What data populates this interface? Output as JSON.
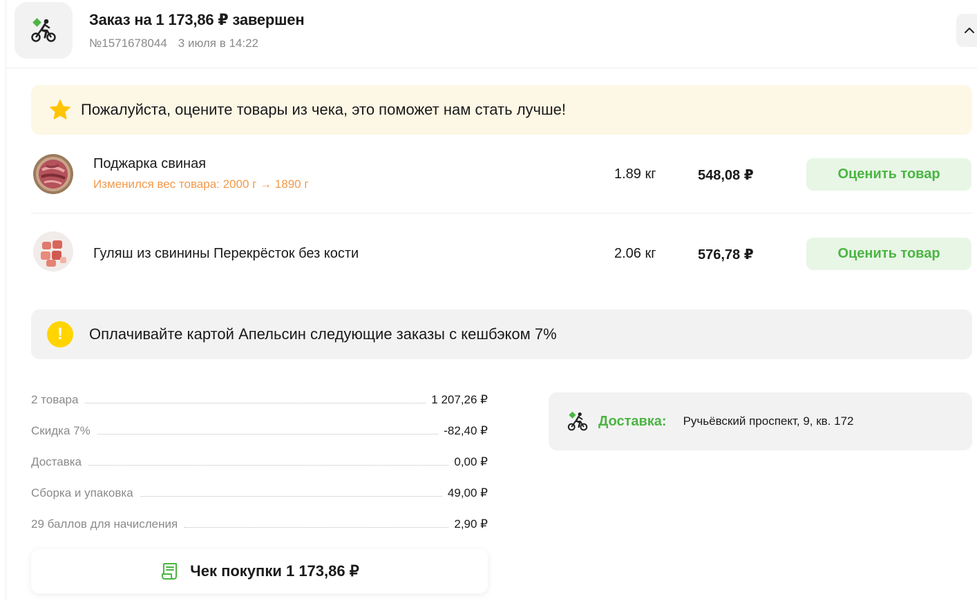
{
  "header": {
    "title": "Заказ на 1 173,86 ₽ завершен",
    "order_number": "№1571678044",
    "date": "3 июля в 14:22",
    "icon": "courier-bike-icon"
  },
  "rate_banner": {
    "text": "Пожалуйста, оцените товары из чека, это поможет нам стать лучше!",
    "icon": "star-icon"
  },
  "products": [
    {
      "name": "Поджарка свиная",
      "note": "Изменился вес товара: 2000 г → 1890 г",
      "weight": "1.89 кг",
      "price": "548,08 ₽",
      "rate_label": "Оценить товар"
    },
    {
      "name": "Гуляш из свинины Перекрёсток без кости",
      "note": "",
      "weight": "2.06 кг",
      "price": "576,78 ₽",
      "rate_label": "Оценить товар"
    }
  ],
  "cashback_banner": {
    "text": "Оплачивайте картой Апельсин следующие заказы с кешбэком 7%",
    "icon_glyph": "!"
  },
  "summary": [
    {
      "label": "2 товара",
      "value": "1 207,26 ₽"
    },
    {
      "label": "Скидка 7%",
      "value": "-82,40 ₽"
    },
    {
      "label": "Доставка",
      "value": "0,00 ₽"
    },
    {
      "label": "Сборка и упаковка",
      "value": "49,00 ₽"
    },
    {
      "label": "29 баллов для начисления",
      "value": "2,90 ₽"
    }
  ],
  "receipt": {
    "label": "Чек покупки 1 173,86 ₽"
  },
  "delivery": {
    "label": "Доставка:",
    "address": "Ручьёвский проспект, 9, кв. 172"
  },
  "colors": {
    "accent_green": "#4bb543",
    "warning_orange": "#f2994a",
    "banner_yellow": "#fdf7e5",
    "badge_yellow": "#ffd400"
  }
}
